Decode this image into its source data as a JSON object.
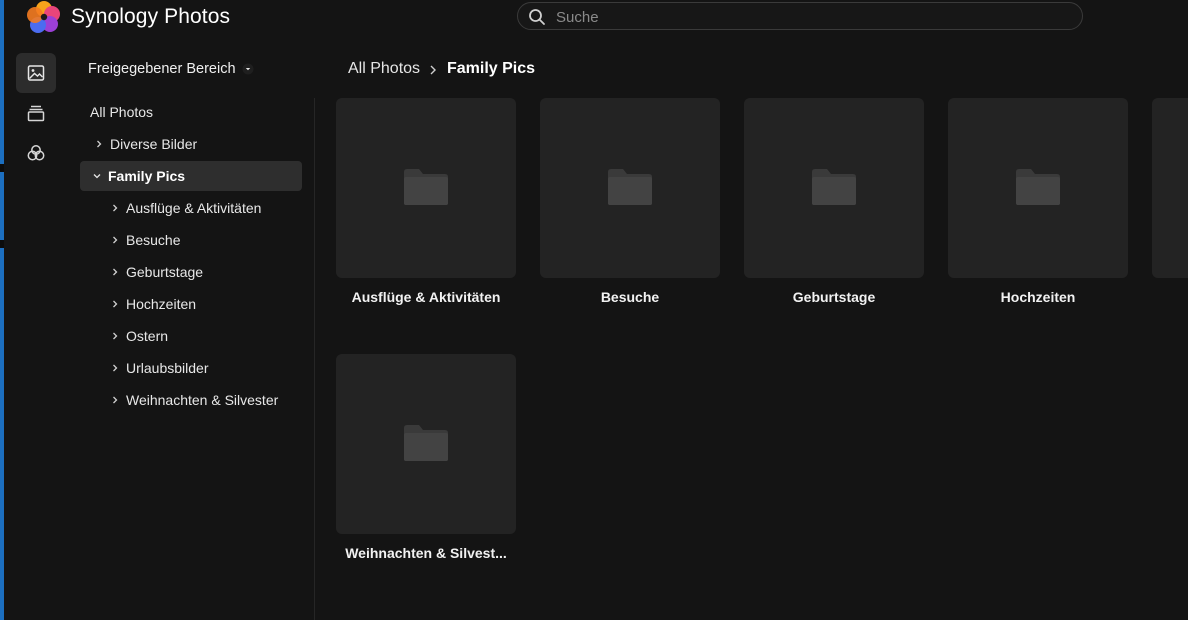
{
  "app": {
    "title": "Synology Photos"
  },
  "search": {
    "placeholder": "Suche",
    "value": ""
  },
  "rail": [
    {
      "name": "photos",
      "active": true
    },
    {
      "name": "albums",
      "active": false
    },
    {
      "name": "sharing",
      "active": false
    }
  ],
  "tree": {
    "space_label": "Freigegebener Bereich",
    "items": [
      {
        "label": "All Photos",
        "level": 0,
        "chevron": "none",
        "selected": false
      },
      {
        "label": "Diverse Bilder",
        "level": 1,
        "chevron": "right",
        "selected": false
      },
      {
        "label": "Family Pics",
        "level": 1,
        "chevron": "down",
        "selected": true
      },
      {
        "label": "Ausflüge & Aktivitäten",
        "level": 2,
        "chevron": "right",
        "selected": false
      },
      {
        "label": "Besuche",
        "level": 2,
        "chevron": "right",
        "selected": false
      },
      {
        "label": "Geburtstage",
        "level": 2,
        "chevron": "right",
        "selected": false
      },
      {
        "label": "Hochzeiten",
        "level": 2,
        "chevron": "right",
        "selected": false
      },
      {
        "label": "Ostern",
        "level": 2,
        "chevron": "right",
        "selected": false
      },
      {
        "label": "Urlaubsbilder",
        "level": 2,
        "chevron": "right",
        "selected": false
      },
      {
        "label": "Weihnachten & Silvester",
        "level": 2,
        "chevron": "right",
        "selected": false
      }
    ]
  },
  "breadcrumb": {
    "root": "All Photos",
    "current": "Family Pics"
  },
  "folders": [
    {
      "label": "Ausflüge & Aktivitäten"
    },
    {
      "label": "Besuche"
    },
    {
      "label": "Geburtstage"
    },
    {
      "label": "Hochzeiten"
    },
    {
      "label": "Weihnachten & Silvest..."
    }
  ],
  "colors": {
    "background": "#141414",
    "tile": "#232323",
    "selected": "#2e2e2e"
  }
}
